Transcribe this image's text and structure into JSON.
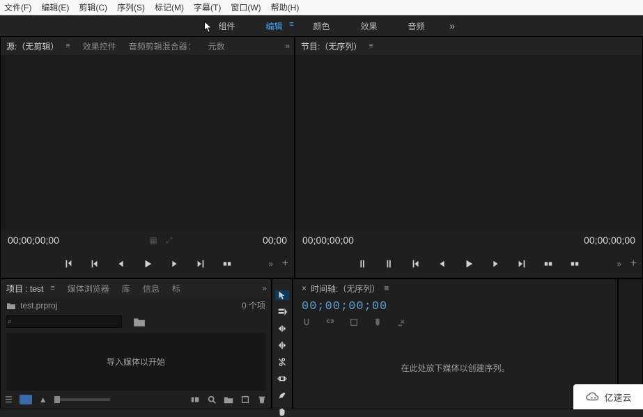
{
  "menubar": [
    "文件(F)",
    "编辑(E)",
    "剪辑(C)",
    "序列(S)",
    "标记(M)",
    "字幕(T)",
    "窗口(W)",
    "帮助(H)"
  ],
  "workspaces": {
    "items": [
      "组件",
      "编辑",
      "颜色",
      "效果",
      "音频"
    ],
    "active_index": 1
  },
  "source": {
    "tabs": [
      "源:（无剪辑）",
      "效果控件",
      "音频剪辑混合器：",
      "元数"
    ],
    "active_index": 0,
    "tc_left": "00;00;00;00",
    "tc_right": "00;00"
  },
  "program": {
    "tab": "节目:（无序列）",
    "tc_left": "00;00;00;00",
    "tc_right": "00;00;00;00"
  },
  "project": {
    "tabs": [
      "项目 : test",
      "媒体浏览器",
      "库",
      "信息",
      "标"
    ],
    "active_index": 0,
    "file": "test.prproj",
    "count": "0 个项",
    "search_placeholder": "",
    "import_prompt": "导入媒体以开始"
  },
  "timeline": {
    "tab": "时间轴:（无序列）",
    "tc": "00;00;00;00",
    "empty_prompt": "在此处放下媒体以创建序列。"
  },
  "watermark": "亿速云"
}
